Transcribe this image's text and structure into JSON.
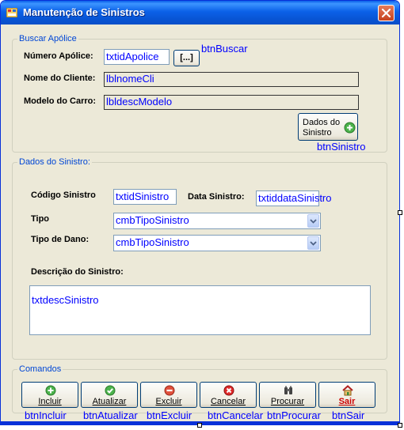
{
  "window": {
    "title": "Manutenção de Sinistros",
    "icon": "app-form-icon",
    "close_icon": "close-icon"
  },
  "buscar_apolice": {
    "legend": "Buscar Apólice",
    "numero_label": "Número Apólice:",
    "numero_value": "txtidApolice",
    "buscar_button": "[...]",
    "buscar_annotation": "btnBuscar",
    "cliente_label": "Nome do Cliente:",
    "cliente_value": "lblnomeCli",
    "modelo_label": "Modelo do Carro:",
    "modelo_value": "lbldescModelo",
    "sinistro_button_line1": "Dados do",
    "sinistro_button_line2": "Sinistro",
    "sinistro_annotation": "btnSinistro"
  },
  "dados_sinistro": {
    "legend": "Dados do Sinistro:",
    "codigo_label": "Código Sinistro",
    "codigo_value": "txtidSinistro",
    "data_label": "Data Sinistro:",
    "data_value": "txtiddataSinistro",
    "tipo_label": "Tipo",
    "tipo_value": "cmbTipoSinistro",
    "dano_label": "Tipo de Dano:",
    "dano_value": "cmbTipoSinistro",
    "descricao_label": "Descrição do Sinistro:",
    "descricao_value": "txtdescSinistro"
  },
  "comandos": {
    "legend": "Comandos",
    "buttons": [
      {
        "label": "Incluir",
        "annotation": "btnIncluir",
        "icon": "add-icon",
        "color": "#3aa33a"
      },
      {
        "label": "Atualizar",
        "annotation": "btnAtualizar",
        "icon": "check-icon",
        "color": "#3aa33a"
      },
      {
        "label": "Excluir",
        "annotation": "btnExcluir",
        "icon": "minus-icon",
        "color": "#d83a2a"
      },
      {
        "label": "Cancelar",
        "annotation": "btnCancelar",
        "icon": "cancel-icon",
        "color": "#d82020"
      },
      {
        "label": "Procurar",
        "annotation": "btnProcurar",
        "icon": "binoculars-icon",
        "color": "#333333"
      },
      {
        "label": "Sair",
        "annotation": "btnSair",
        "icon": "home-exit-icon",
        "color": "#cc0000"
      }
    ]
  },
  "colors": {
    "titlebar": "#0b61e8",
    "form_bg": "#ece9d8",
    "group_legend": "#0046d5",
    "annotation": "#0000ff"
  }
}
